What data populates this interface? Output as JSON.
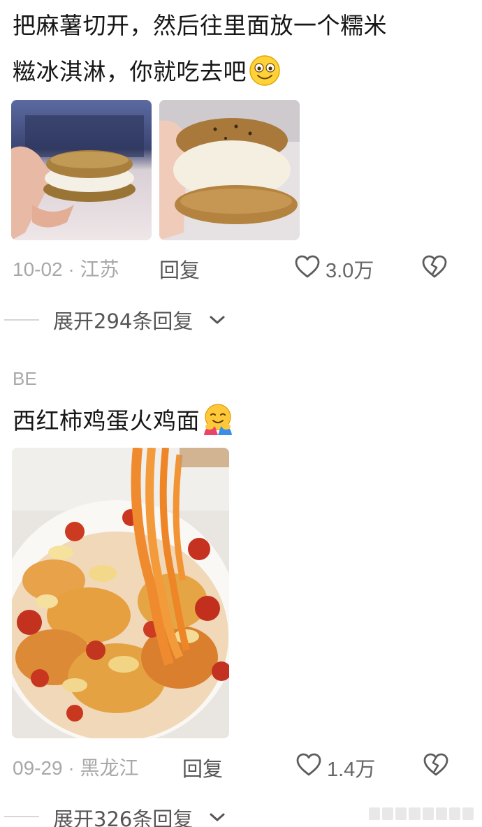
{
  "comments": [
    {
      "text_line1": "把麻薯切开，然后往里面放一个糯米",
      "text_line2": "糍冰淇淋，你就吃去吧",
      "emoji": "smiling-face-icon",
      "photos": [
        {
          "name": "mochi-sandwich-photo-1",
          "description_icon": "photo"
        },
        {
          "name": "mochi-sandwich-photo-2",
          "description_icon": "photo"
        }
      ],
      "date": "10-02",
      "separator": "·",
      "location": "江苏",
      "reply_label": "回复",
      "likes": "3.0万",
      "expand_label": "展开294条回复"
    },
    {
      "username": "BE",
      "text": "西红柿鸡蛋火鸡面",
      "emoji": "hugging-face-icon",
      "photos": [
        {
          "name": "noodles-photo",
          "description_icon": "photo"
        }
      ],
      "date": "09-29",
      "separator": "·",
      "location": "黑龙江",
      "reply_label": "回复",
      "likes": "1.4万",
      "expand_label": "展开326条回复"
    }
  ],
  "colors": {
    "text": "#161616",
    "meta": "#a8a8a8",
    "action": "#555555",
    "divider": "#d6d6d6"
  }
}
